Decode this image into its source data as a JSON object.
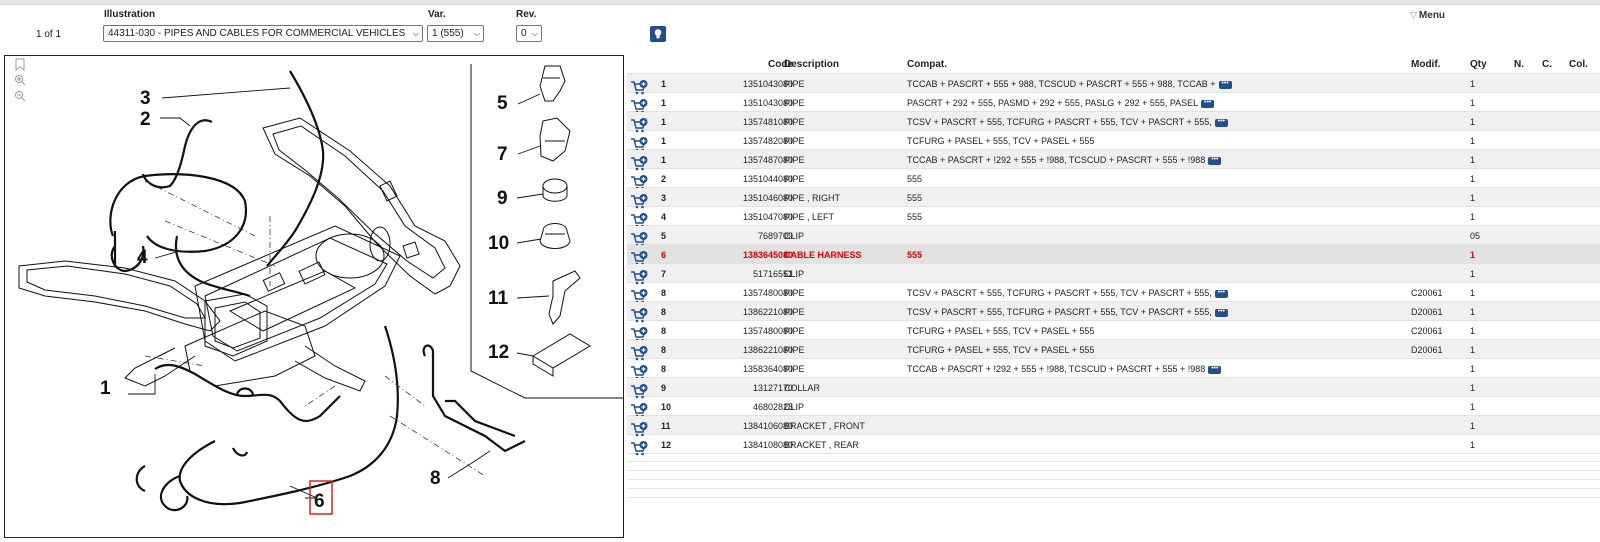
{
  "header": {
    "pager": "1 of 1",
    "illustration_label": "Illustration",
    "illustration_value": "44311-030 - PIPES AND CABLES FOR COMMERCIAL VEHICLES",
    "var_label": "Var.",
    "var_value": "1 (555)",
    "rev_label": "Rev.",
    "rev_value": "0",
    "menu_label": "Menu"
  },
  "diagram": {
    "callouts": [
      "1",
      "2",
      "3",
      "4",
      "5",
      "6",
      "7",
      "8",
      "9",
      "10",
      "11",
      "12"
    ]
  },
  "table": {
    "columns": {
      "code": "Code",
      "description": "Description",
      "compat": "Compat.",
      "modif": "Modif.",
      "qty": "Qty",
      "n": "N.",
      "c": "C.",
      "col": "Col."
    },
    "rows": [
      {
        "idx": "1",
        "code": "1351043080",
        "desc": "PIPE",
        "compat": "TCCAB + PASCRT + 555 + 988, TCSCUD + PASCRT + 555 + 988, TCCAB +",
        "more": true,
        "modif": "",
        "qty": "1"
      },
      {
        "idx": "1",
        "code": "1351043080",
        "desc": "PIPE",
        "compat": "PASCRT + 292 + 555, PASMD + 292 + 555, PASLG + 292 + 555, PASEL",
        "more": true,
        "modif": "",
        "qty": "1"
      },
      {
        "idx": "1",
        "code": "1357481080",
        "desc": "PIPE",
        "compat": "TCSV + PASCRT + 555, TCFURG + PASCRT + 555, TCV + PASCRT + 555,",
        "more": true,
        "modif": "",
        "qty": "1"
      },
      {
        "idx": "1",
        "code": "1357482080",
        "desc": "PIPE",
        "compat": "TCFURG + PASEL + 555, TCV + PASEL + 555",
        "more": false,
        "modif": "",
        "qty": "1"
      },
      {
        "idx": "1",
        "code": "1357487080",
        "desc": "PIPE",
        "compat": "TCCAB + PASCRT + !292 + 555 + !988, TCSCUD + PASCRT + 555 + !988",
        "more": true,
        "modif": "",
        "qty": "1"
      },
      {
        "idx": "2",
        "code": "1351044080",
        "desc": "PIPE",
        "compat": "555",
        "more": false,
        "modif": "",
        "qty": "1"
      },
      {
        "idx": "3",
        "code": "1351046080",
        "desc": "PIPE , RIGHT",
        "compat": "555",
        "more": false,
        "modif": "",
        "qty": "1"
      },
      {
        "idx": "4",
        "code": "1351047080",
        "desc": "PIPE , LEFT",
        "compat": "555",
        "more": false,
        "modif": "",
        "qty": "1"
      },
      {
        "idx": "5",
        "code": "7689709",
        "desc": "CLIP",
        "compat": "",
        "more": false,
        "modif": "",
        "qty": "05"
      },
      {
        "idx": "6",
        "code": "1383645080",
        "desc": "CABLE HARNESS",
        "compat": "555",
        "more": false,
        "modif": "",
        "qty": "1"
      },
      {
        "idx": "7",
        "code": "51716551",
        "desc": "CLIP",
        "compat": "",
        "more": false,
        "modif": "",
        "qty": "1"
      },
      {
        "idx": "8",
        "code": "1357480080",
        "desc": "PIPE",
        "compat": "TCSV + PASCRT + 555, TCFURG + PASCRT + 555, TCV + PASCRT + 555,",
        "more": true,
        "modif": "C20061",
        "qty": "1"
      },
      {
        "idx": "8",
        "code": "1386221080",
        "desc": "PIPE",
        "compat": "TCSV + PASCRT + 555, TCFURG + PASCRT + 555, TCV + PASCRT + 555,",
        "more": true,
        "modif": "D20061",
        "qty": "1"
      },
      {
        "idx": "8",
        "code": "1357480080",
        "desc": "PIPE",
        "compat": "TCFURG + PASEL + 555, TCV + PASEL + 555",
        "more": false,
        "modif": "C20061",
        "qty": "1"
      },
      {
        "idx": "8",
        "code": "1386221080",
        "desc": "PIPE",
        "compat": "TCFURG + PASEL + 555, TCV + PASEL + 555",
        "more": false,
        "modif": "D20061",
        "qty": "1"
      },
      {
        "idx": "8",
        "code": "1358364080",
        "desc": "PIPE",
        "compat": "TCCAB + PASCRT + !292 + 555 + !988, TCSCUD + PASCRT + 555 + !988",
        "more": true,
        "modif": "",
        "qty": "1"
      },
      {
        "idx": "9",
        "code": "13127170",
        "desc": "COLLAR",
        "compat": "",
        "more": false,
        "modif": "",
        "qty": "1"
      },
      {
        "idx": "10",
        "code": "46802828",
        "desc": "CLIP",
        "compat": "",
        "more": false,
        "modif": "",
        "qty": "1"
      },
      {
        "idx": "11",
        "code": "1384106080",
        "desc": "BRACKET , FRONT",
        "compat": "",
        "more": false,
        "modif": "",
        "qty": "1"
      },
      {
        "idx": "12",
        "code": "1384108080",
        "desc": "BRACKET , REAR",
        "compat": "",
        "more": false,
        "modif": "",
        "qty": "1"
      }
    ],
    "highlighted_index": 9,
    "colors": {
      "highlight_text": "#dd0000",
      "accent": "#1d4f91"
    },
    "icons": [
      "add-to-cart-icon",
      "more-icon",
      "lightbulb-icon",
      "zoom-in-icon",
      "zoom-out-icon",
      "bookmark-icon"
    ]
  }
}
